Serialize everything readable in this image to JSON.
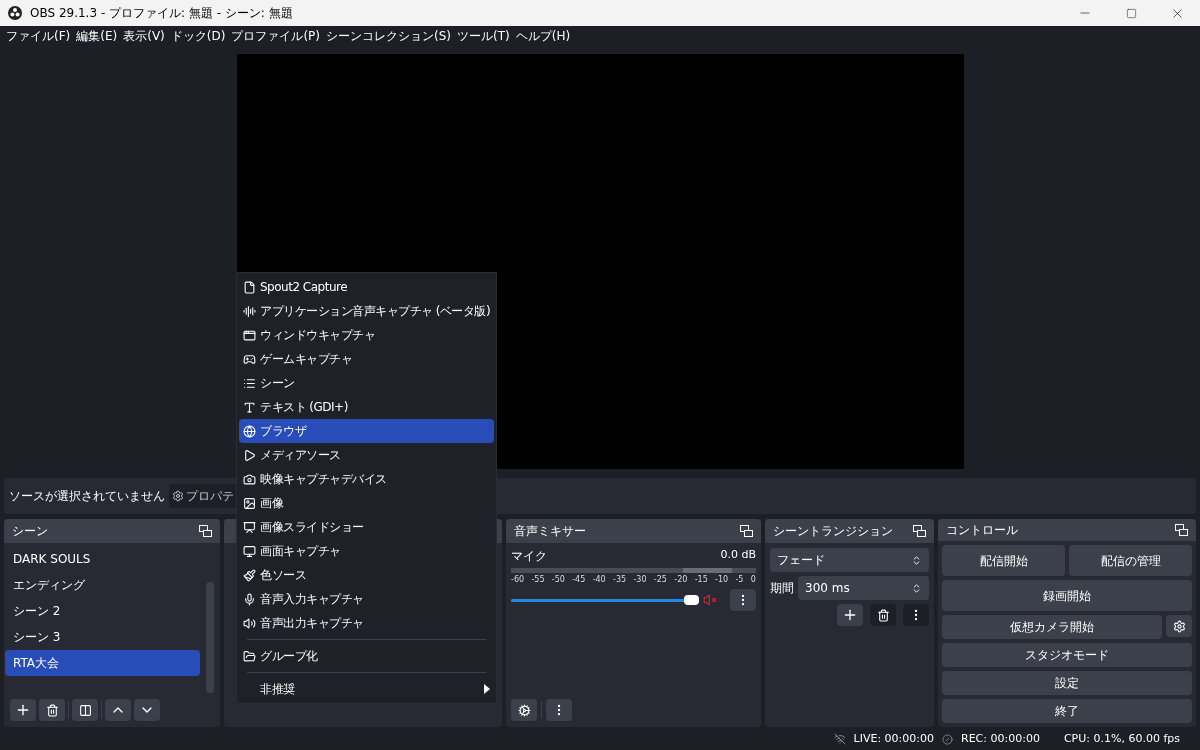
{
  "window": {
    "title": "OBS 29.1.3 - プロファイル: 無題 - シーン: 無題"
  },
  "menubar": [
    "ファイル(F)",
    "編集(E)",
    "表示(V)",
    "ドック(D)",
    "プロファイル(P)",
    "シーンコレクション(S)",
    "ツール(T)",
    "ヘルプ(H)"
  ],
  "source_bar": {
    "status": "ソースが選択されていません",
    "properties_button": "プロパテ"
  },
  "context_menu": [
    {
      "kind": "item",
      "label": "Spout2 Capture",
      "selected": false
    },
    {
      "kind": "item",
      "label": "アプリケーション音声キャプチャ (ベータ版)",
      "selected": false
    },
    {
      "kind": "item",
      "label": "ウィンドウキャプチャ",
      "selected": false
    },
    {
      "kind": "item",
      "label": "ゲームキャプチャ",
      "selected": false
    },
    {
      "kind": "item",
      "label": "シーン",
      "selected": false
    },
    {
      "kind": "item",
      "label": "テキスト (GDI+)",
      "selected": false
    },
    {
      "kind": "item",
      "label": "ブラウザ",
      "selected": true
    },
    {
      "kind": "item",
      "label": "メディアソース",
      "selected": false
    },
    {
      "kind": "item",
      "label": "映像キャプチャデバイス",
      "selected": false
    },
    {
      "kind": "item",
      "label": "画像",
      "selected": false
    },
    {
      "kind": "item",
      "label": "画像スライドショー",
      "selected": false
    },
    {
      "kind": "item",
      "label": "画面キャプチャ",
      "selected": false
    },
    {
      "kind": "item",
      "label": "色ソース",
      "selected": false
    },
    {
      "kind": "item",
      "label": "音声入力キャプチャ",
      "selected": false
    },
    {
      "kind": "item",
      "label": "音声出力キャプチャ",
      "selected": false
    },
    {
      "kind": "separator"
    },
    {
      "kind": "item",
      "label": "グループ化",
      "selected": false
    },
    {
      "kind": "separator"
    },
    {
      "kind": "submenu",
      "label": "非推奨",
      "selected": false
    }
  ],
  "scenes": {
    "title": "シーン",
    "items": [
      {
        "label": "DARK SOULS",
        "selected": false
      },
      {
        "label": "エンディング",
        "selected": false
      },
      {
        "label": "シーン 2",
        "selected": false
      },
      {
        "label": "シーン 3",
        "selected": false
      },
      {
        "label": "RTA大会",
        "selected": true
      }
    ]
  },
  "mixer": {
    "title": "音声ミキサー",
    "channels": [
      {
        "name": "マイク",
        "reading": "0.0 dB",
        "level": 1,
        "muted": true,
        "ticks": [
          "-60",
          "-55",
          "-50",
          "-45",
          "-40",
          "-35",
          "-30",
          "-25",
          "-20",
          "-15",
          "-10",
          "-5",
          "0"
        ]
      }
    ]
  },
  "transitions": {
    "title": "シーントランジション",
    "transition": "フェード",
    "duration_label": "期間",
    "duration": "300 ms"
  },
  "controls": {
    "title": "コントロール",
    "buttons": [
      "配信開始",
      "配信の管理",
      "録画開始",
      "仮想カメラ開始",
      "スタジオモード",
      "設定",
      "終了"
    ]
  },
  "status_bar": {
    "live": "LIVE: 00:00:00",
    "rec": "REC: 00:00:00",
    "cpu": "CPU: 0.1%, 60.00 fps"
  }
}
